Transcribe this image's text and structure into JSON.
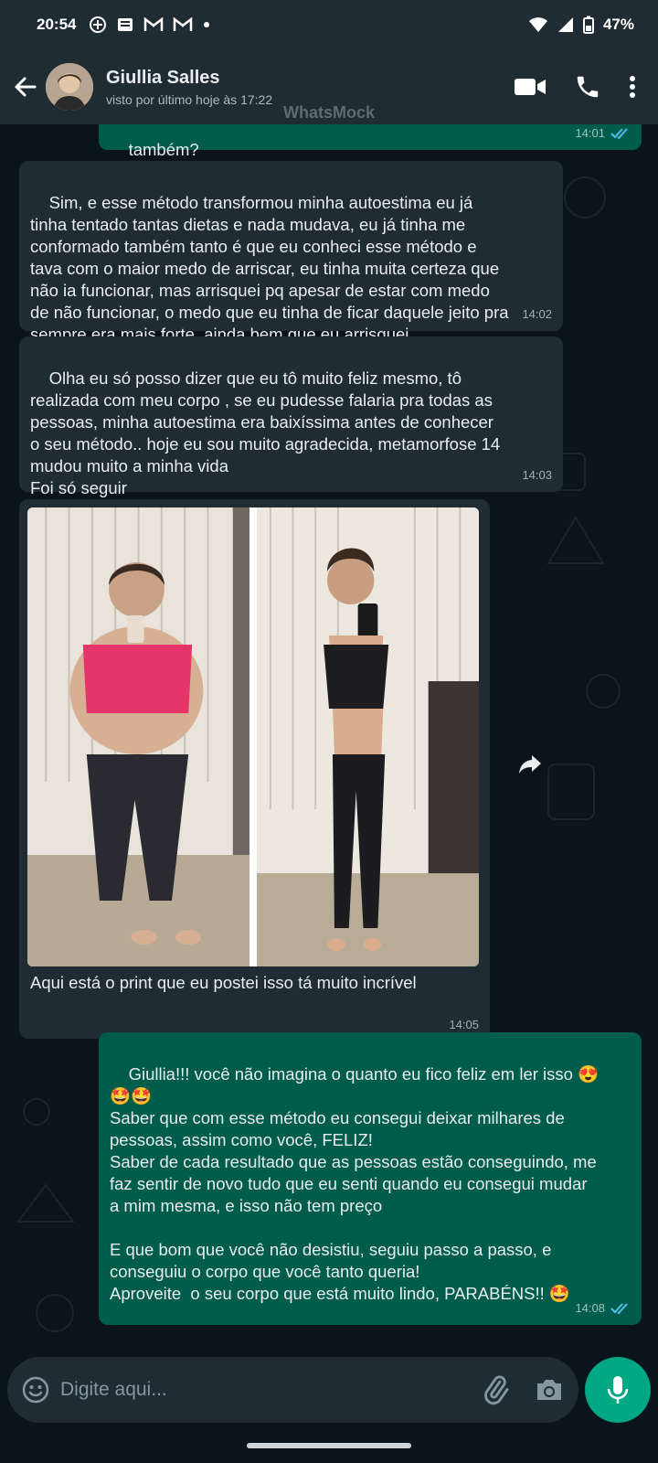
{
  "status_bar": {
    "time": "20:54",
    "battery": "47%"
  },
  "header": {
    "name": "Giullia Salles",
    "last_seen": "visto por último hoje às 17:22"
  },
  "watermark": "WhatsMock",
  "messages": [
    {
      "direction": "out",
      "text": "também?",
      "time": "14:01",
      "read": true
    },
    {
      "direction": "in",
      "text": "Sim, e esse método transformou minha autoestima eu já\ntinha tentado tantas dietas e nada mudava, eu já tinha me\nconformado também tanto é que eu conheci esse método e\ntava com o maior medo de arriscar, eu tinha muita certeza que\nnão ia funcionar, mas arrisquei pq apesar de estar com medo\nde não funcionar, o medo que eu tinha de ficar daquele jeito pra\nsempre era mais forte, ainda bem que eu arrisquei",
      "time": "14:02"
    },
    {
      "direction": "in",
      "text": "Olha eu só posso dizer que eu tô muito feliz mesmo, tô\nrealizada com meu corpo , se eu pudesse falaria pra todas as\npessoas, minha autoestima era baixíssima antes de conhecer\no seu método.. hoje eu sou muito agradecida, metamorfose 14\nmudou muito a minha vida\nFoi só seguir",
      "time": "14:03"
    },
    {
      "direction": "in",
      "type": "image",
      "caption": "Aqui está o print que eu postei isso tá muito incrível",
      "time": "14:05"
    },
    {
      "direction": "out",
      "text": "Giullia!!! você não imagina o quanto eu fico feliz em ler isso 😍\n🤩🤩\nSaber que com esse método eu consegui deixar milhares de\npessoas, assim como você, FELIZ!\nSaber de cada resultado que as pessoas estão conseguindo, me\nfaz sentir de novo tudo que eu senti quando eu consegui mudar\na mim mesma, e isso não tem preço\n\nE que bom que você não desistiu, seguiu passo a passo, e\nconseguiu o corpo que você tanto queria!\nAproveite  o seu corpo que está muito lindo, PARABÉNS!! 🤩",
      "time": "14:08",
      "read": true
    }
  ],
  "composer": {
    "placeholder": "Digite aqui..."
  },
  "icons": [
    "back-arrow-icon",
    "video-call-icon",
    "phone-icon",
    "more-vert-icon",
    "forward-icon",
    "emoji-icon",
    "attach-icon",
    "camera-icon",
    "mic-icon",
    "read-receipt-icon"
  ],
  "colors": {
    "incoming": "#202c33",
    "outgoing": "#005c4b",
    "accent": "#00a884",
    "background": "#0b141a"
  }
}
